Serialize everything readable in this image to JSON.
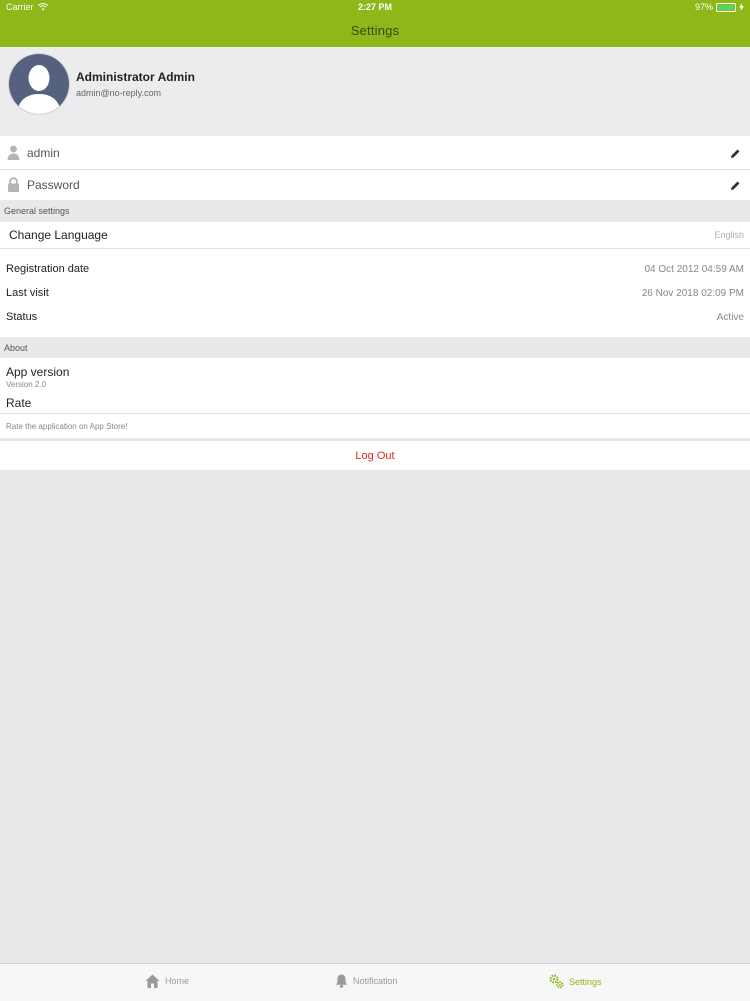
{
  "status_bar": {
    "carrier": "Carrier",
    "time": "2:27 PM",
    "battery": "97%",
    "battery_level": 0.97
  },
  "nav": {
    "title": "Settings"
  },
  "profile": {
    "name": "Administrator Admin",
    "email": "admin@no-reply.com"
  },
  "account": {
    "username": "admin",
    "password_placeholder": "Password"
  },
  "general": {
    "header": "General settings",
    "change_language_label": "Change Language",
    "language_value": "English",
    "registration_label": "Registration date",
    "registration_value": "04 Oct 2012 04:59 AM",
    "last_visit_label": "Last visit",
    "last_visit_value": "26 Nov 2018 02:09 PM",
    "status_label": "Status",
    "status_value": "Active"
  },
  "about": {
    "header": "About",
    "app_version_label": "App version",
    "app_version_value": "Version 2.0",
    "rate_label": "Rate",
    "rate_description": "Rate the application on App Store!"
  },
  "logout": {
    "label": "Log Out"
  },
  "tabs": [
    {
      "label": "Home",
      "icon": "home-icon",
      "active": false
    },
    {
      "label": "Notification",
      "icon": "bell-icon",
      "active": false
    },
    {
      "label": "Settings",
      "icon": "gears-icon",
      "active": true
    }
  ],
  "colors": {
    "accent": "#8fb719",
    "logout": "#e3261f",
    "background": "#e9e9ec"
  }
}
